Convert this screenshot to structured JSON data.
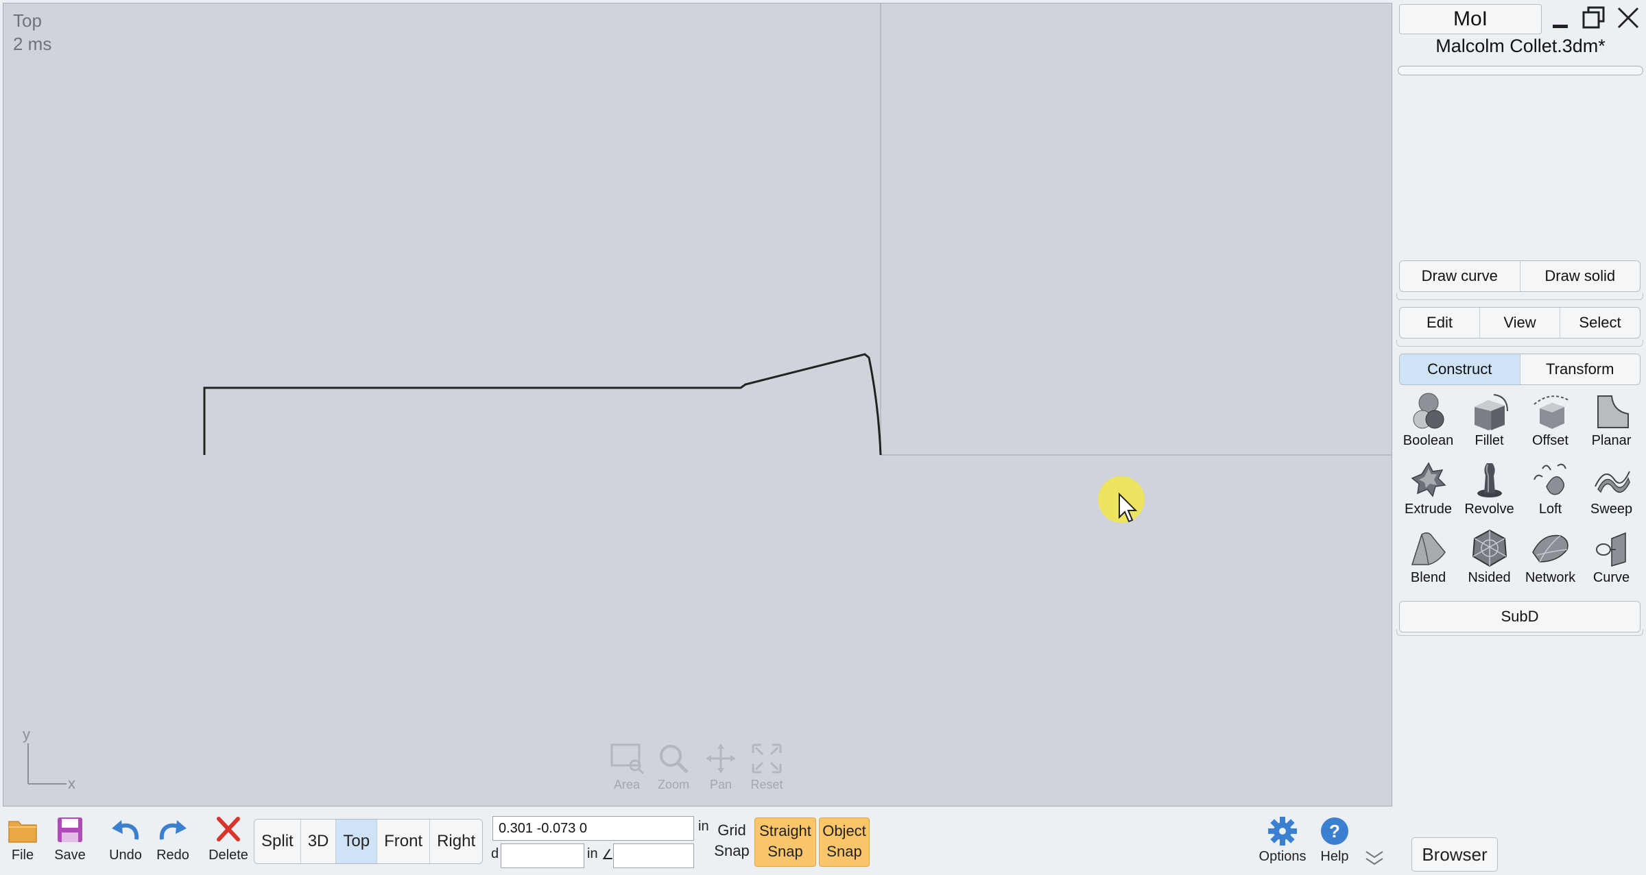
{
  "viewport": {
    "title": "Top",
    "render_time": "2 ms",
    "axis_y": "y",
    "axis_x": "x",
    "nav": [
      {
        "label": "Area",
        "icon": "area-zoom-icon"
      },
      {
        "label": "Zoom",
        "icon": "magnifier-icon"
      },
      {
        "label": "Pan",
        "icon": "pan-arrows-icon"
      },
      {
        "label": "Reset",
        "icon": "reset-view-icon"
      }
    ]
  },
  "toolbar": {
    "file": "File",
    "save": "Save",
    "undo": "Undo",
    "redo": "Redo",
    "delete": "Delete",
    "views": [
      {
        "label": "Split",
        "active": false
      },
      {
        "label": "3D",
        "active": false
      },
      {
        "label": "Top",
        "active": true
      },
      {
        "label": "Front",
        "active": false
      },
      {
        "label": "Right",
        "active": false
      }
    ],
    "coords": "0.301     -0.073     0",
    "unit1": "in",
    "distance_prefix": "d",
    "unit2": "in",
    "angle_symbol": "∠",
    "grid_snap": {
      "line1": "Grid",
      "line2": "Snap"
    },
    "straight_snap": {
      "line1": "Straight",
      "line2": "Snap"
    },
    "object_snap": {
      "line1": "Object",
      "line2": "Snap"
    },
    "options": "Options",
    "help": "Help",
    "browser": "Browser"
  },
  "panel": {
    "app_name": "MoI",
    "file_name": "Malcolm Collet.3dm*",
    "draw_tabs": [
      "Draw curve",
      "Draw solid"
    ],
    "edit_tabs": [
      "Edit",
      "View",
      "Select"
    ],
    "construct_tabs": [
      {
        "label": "Construct",
        "active": true
      },
      {
        "label": "Transform",
        "active": false
      }
    ],
    "tools": [
      {
        "label": "Boolean",
        "icon": "boolean-icon"
      },
      {
        "label": "Fillet",
        "icon": "fillet-icon"
      },
      {
        "label": "Offset",
        "icon": "offset-icon"
      },
      {
        "label": "Planar",
        "icon": "planar-icon"
      },
      {
        "label": "Extrude",
        "icon": "extrude-icon"
      },
      {
        "label": "Revolve",
        "icon": "revolve-icon"
      },
      {
        "label": "Loft",
        "icon": "loft-icon"
      },
      {
        "label": "Sweep",
        "icon": "sweep-icon"
      },
      {
        "label": "Blend",
        "icon": "blend-icon"
      },
      {
        "label": "Nsided",
        "icon": "nsided-icon"
      },
      {
        "label": "Network",
        "icon": "network-icon"
      },
      {
        "label": "Curve",
        "icon": "curve-icon"
      }
    ],
    "subd": "SubD"
  },
  "colors": {
    "viewport_bg": "#d0d4da",
    "active_tab": "#cfe3f7",
    "snap_active": "#f9c66b",
    "accent_blue": "#3a7fd0",
    "delete_red": "#d9342b",
    "cursor_highlight": "#f2e64a"
  }
}
